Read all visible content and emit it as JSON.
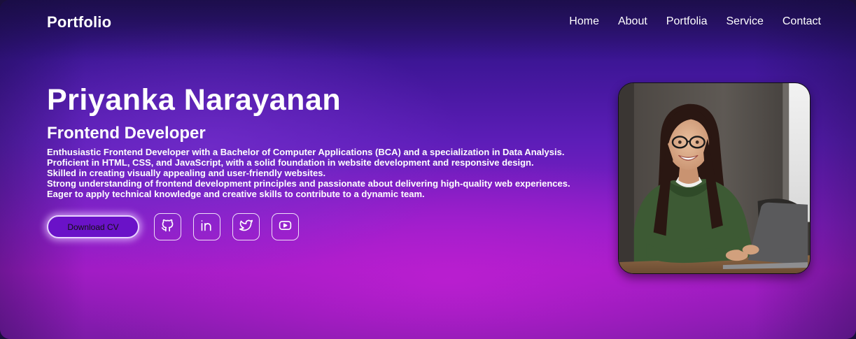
{
  "nav": {
    "logo": "Portfolio",
    "links": [
      "Home",
      "About",
      "Portfolia",
      "Service",
      "Contact"
    ]
  },
  "hero": {
    "name": "Priyanka Narayanan",
    "role": "Frontend Developer",
    "description": [
      "Enthusiastic Frontend Developer with a Bachelor of Computer Applications (BCA) and a specialization in Data Analysis.",
      "Proficient in HTML, CSS, and JavaScript, with a solid foundation in website development and responsive design.",
      "Skilled in creating visually appealing and user-friendly websites.",
      "Strong understanding of frontend development principles and passionate about delivering high-quality web experiences.",
      "Eager to apply technical knowledge and creative skills to contribute to a dynamic team."
    ],
    "cv_button": "Download CV"
  },
  "socials": [
    {
      "icon": "github-icon"
    },
    {
      "icon": "linkedin-icon"
    },
    {
      "icon": "twitter-icon"
    },
    {
      "icon": "youtube-icon"
    }
  ],
  "photo": {
    "subject": "profile-photo"
  },
  "colors": {
    "background_top": "#27136b",
    "background_mid": "#5d1db8",
    "background_glow": "#b01ec8",
    "button_fill": "#6a12c8",
    "text": "#ffffff"
  }
}
